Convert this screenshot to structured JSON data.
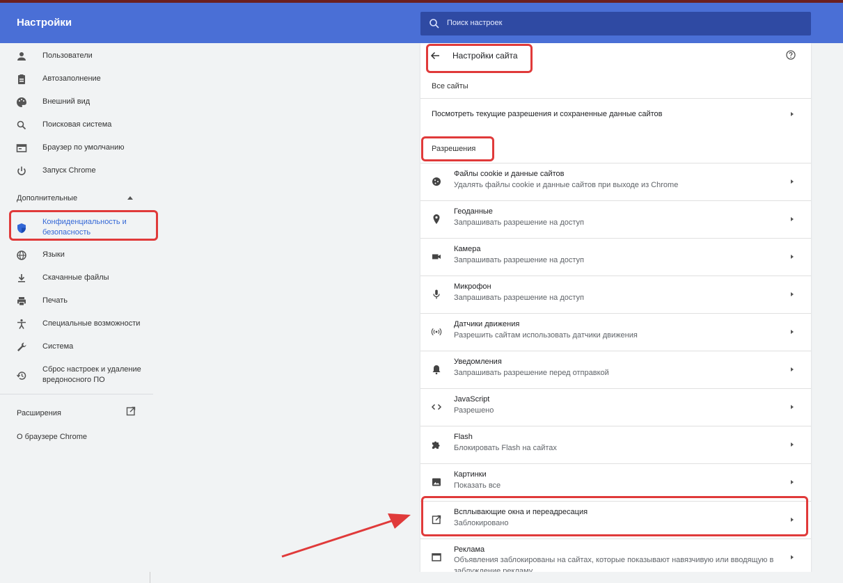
{
  "header": {
    "title": "Настройки",
    "search_placeholder": "Поиск настроек"
  },
  "sidebar": {
    "items": [
      {
        "label": "Пользователи",
        "icon": "person-icon"
      },
      {
        "label": "Автозаполнение",
        "icon": "clipboard-icon"
      },
      {
        "label": "Внешний вид",
        "icon": "palette-icon"
      },
      {
        "label": "Поисковая система",
        "icon": "search-icon"
      },
      {
        "label": "Браузер по умолчанию",
        "icon": "browser-icon"
      },
      {
        "label": "Запуск Chrome",
        "icon": "power-icon"
      }
    ],
    "advanced_label": "Дополнительные",
    "advanced_items": [
      {
        "label": "Конфиденциальность и безопасность",
        "icon": "shield-icon",
        "active": true
      },
      {
        "label": "Языки",
        "icon": "globe-icon"
      },
      {
        "label": "Скачанные файлы",
        "icon": "download-icon"
      },
      {
        "label": "Печать",
        "icon": "printer-icon"
      },
      {
        "label": "Специальные возможности",
        "icon": "accessibility-icon"
      },
      {
        "label": "Система",
        "icon": "wrench-icon"
      },
      {
        "label": "Сброс настроек и удаление вредоносного ПО",
        "icon": "restore-icon"
      }
    ],
    "extensions_label": "Расширения",
    "about_label": "О браузере Chrome"
  },
  "site_settings": {
    "title": "Настройки сайта",
    "all_sites_header": "Все сайты",
    "all_sites_row": "Посмотреть текущие разрешения и сохраненные данные сайтов",
    "permissions_header": "Разрешения",
    "permissions": [
      {
        "title": "Файлы cookie и данные сайтов",
        "subtitle": "Удалять файлы cookie и данные сайтов при выходе из Chrome",
        "icon": "cookie-icon"
      },
      {
        "title": "Геоданные",
        "subtitle": "Запрашивать разрешение на доступ",
        "icon": "location-pin-icon"
      },
      {
        "title": "Камера",
        "subtitle": "Запрашивать разрешение на доступ",
        "icon": "camera-icon"
      },
      {
        "title": "Микрофон",
        "subtitle": "Запрашивать разрешение на доступ",
        "icon": "microphone-icon"
      },
      {
        "title": "Датчики движения",
        "subtitle": "Разрешить сайтам использовать датчики движения",
        "icon": "sensors-icon"
      },
      {
        "title": "Уведомления",
        "subtitle": "Запрашивать разрешение перед отправкой",
        "icon": "bell-icon"
      },
      {
        "title": "JavaScript",
        "subtitle": "Разрешено",
        "icon": "code-icon"
      },
      {
        "title": "Flash",
        "subtitle": "Блокировать Flash на сайтах",
        "icon": "puzzle-icon"
      },
      {
        "title": "Картинки",
        "subtitle": "Показать все",
        "icon": "image-icon"
      },
      {
        "title": "Всплывающие окна и переадресация",
        "subtitle": "Заблокировано",
        "icon": "open-in-new-icon"
      },
      {
        "title": "Реклама",
        "subtitle": "Объявления заблокированы на сайтах, которые показывают навязчивую или вводящую в заблуждение рекламу",
        "icon": "ad-window-icon"
      }
    ]
  },
  "colors": {
    "header_blue": "#4a6fd6",
    "search_bg": "#2f4aa3",
    "highlight_red": "#e03a3a",
    "active_blue": "#3367d6"
  }
}
